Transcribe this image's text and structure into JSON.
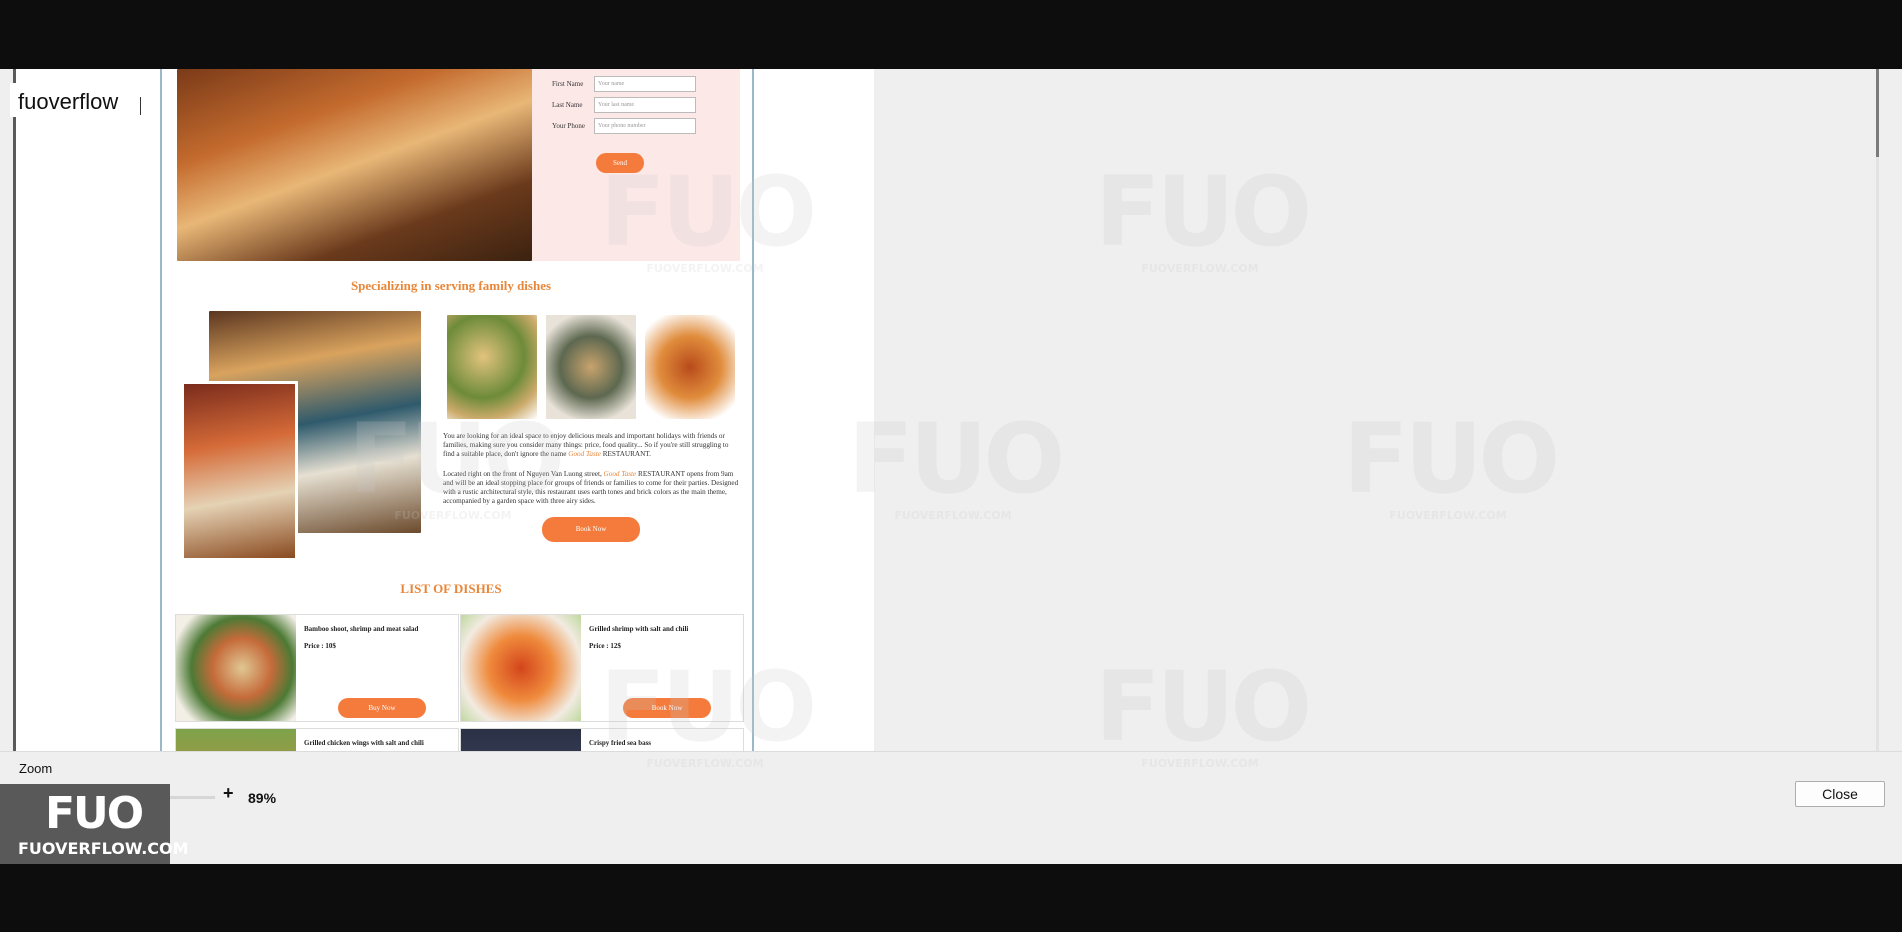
{
  "window": {
    "title": "fuoverflow"
  },
  "preview": {
    "form": {
      "rows": [
        {
          "label": "First Name",
          "placeholder": "Your name"
        },
        {
          "label": "Last Name",
          "placeholder": "Your last name"
        },
        {
          "label": "Your Phone",
          "placeholder": "Your phone number"
        }
      ],
      "send_label": "Send"
    },
    "section_title": "Specializing in serving family dishes",
    "paragraph1": "You are looking for an ideal space to enjoy delicious meals and important holidays with friends or families, making sure you consider many things: price, food quality... So if you're still struggling to find a suitable place, don't ignore the name",
    "paragraph1_brand": "Good Taste",
    "paragraph1_end": "RESTAURANT.",
    "paragraph2_start": "Located right on the front of Nguyen Van Luong street,",
    "paragraph2_brand": "Good Taste",
    "paragraph2_end": "RESTAURANT opens from 9am and will be an ideal stopping place for groups of friends or families to come for their parties. Designed with a rustic architectural style, this restaurant uses earth tones and brick colors as the main theme, accompanied by a garden space with three airy sides.",
    "book_label": "Book Now",
    "list_title": "LIST OF DISHES",
    "dishes": [
      {
        "name": "Bamboo shoot, shrimp and meat salad",
        "price": "Price : 10$",
        "button": "Buy Now"
      },
      {
        "name": "Grilled shrimp with salt and chili",
        "price": "Price : 12$",
        "button": "Book Now"
      },
      {
        "name": "Grilled chicken wings with salt and chili"
      },
      {
        "name": "Crispy fried sea bass"
      }
    ]
  },
  "watermark": {
    "mark": "FUO",
    "text": "FUOVERFLOW.COM"
  },
  "footer": {
    "zoom_label": "Zoom",
    "minus": "-",
    "plus": "+",
    "zoom_value": "89%",
    "close_label": "Close",
    "logo_mark": "FUO",
    "logo_text": "FUOVERFLOW.COM"
  }
}
